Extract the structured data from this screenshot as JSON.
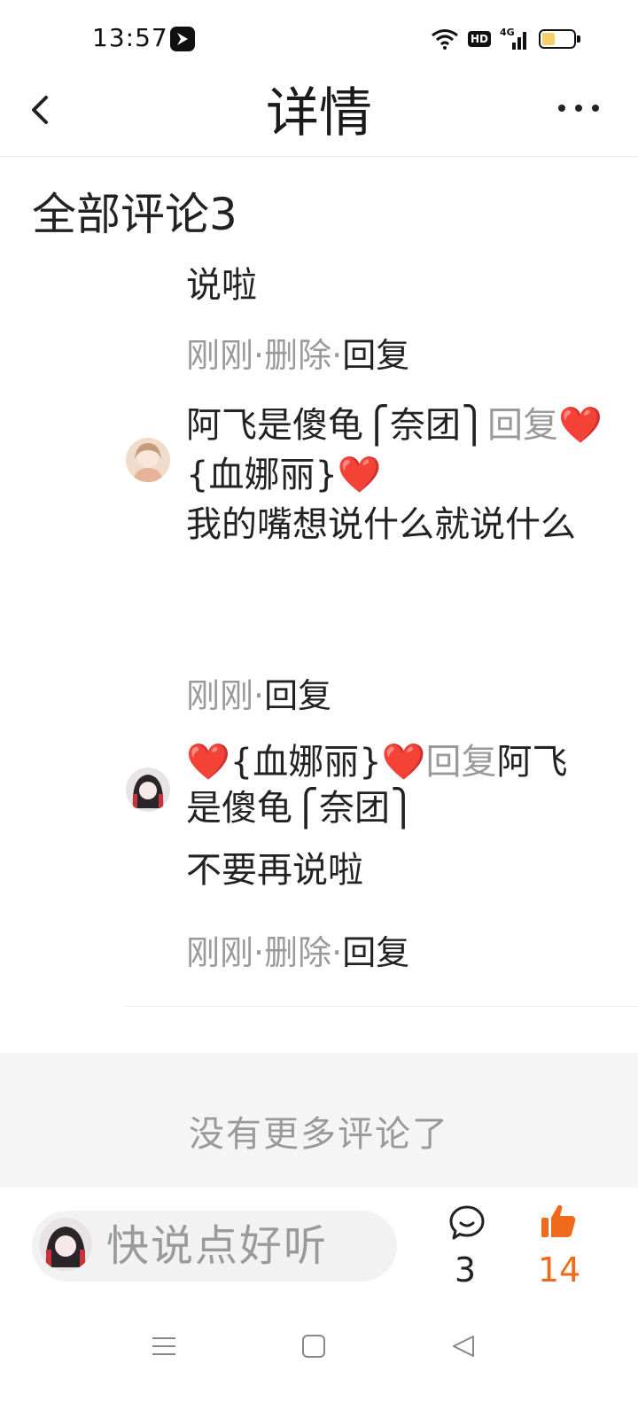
{
  "status_bar": {
    "time": "13:57",
    "hd": "HD",
    "network": "4G",
    "battery_level": 0.45
  },
  "header": {
    "title": "详情",
    "back_icon": "chevron-left-icon",
    "more_icon": "more-horizontal-icon"
  },
  "section": {
    "title": "全部评论3"
  },
  "comments": [
    {
      "text": "说啦",
      "time": "刚刚",
      "sep1": "·",
      "delete": "删除",
      "sep2": "·",
      "reply": "回复"
    },
    {
      "author": "阿飞是傻龟⎧奈团⎫",
      "reply_word": "回复",
      "target": "❤️{血娜丽}❤️",
      "text": "我的嘴想说什么就说什么",
      "time": "刚刚",
      "sep1": "·",
      "reply": "回复"
    },
    {
      "author": "❤️{血娜丽}❤️",
      "reply_word": "回复",
      "target": "阿飞是傻龟⎧奈团⎫",
      "text": "不要再说啦",
      "time": "刚刚",
      "sep1": "·",
      "delete": "删除",
      "sep2": "·",
      "reply": "回复"
    }
  ],
  "no_more": "没有更多评论了",
  "bottom_bar": {
    "placeholder": "快说点好听",
    "comment_count": "3",
    "like_count": "14"
  },
  "colors": {
    "accent": "#f06a1c",
    "muted": "#9a9a9a",
    "text": "#222222"
  }
}
